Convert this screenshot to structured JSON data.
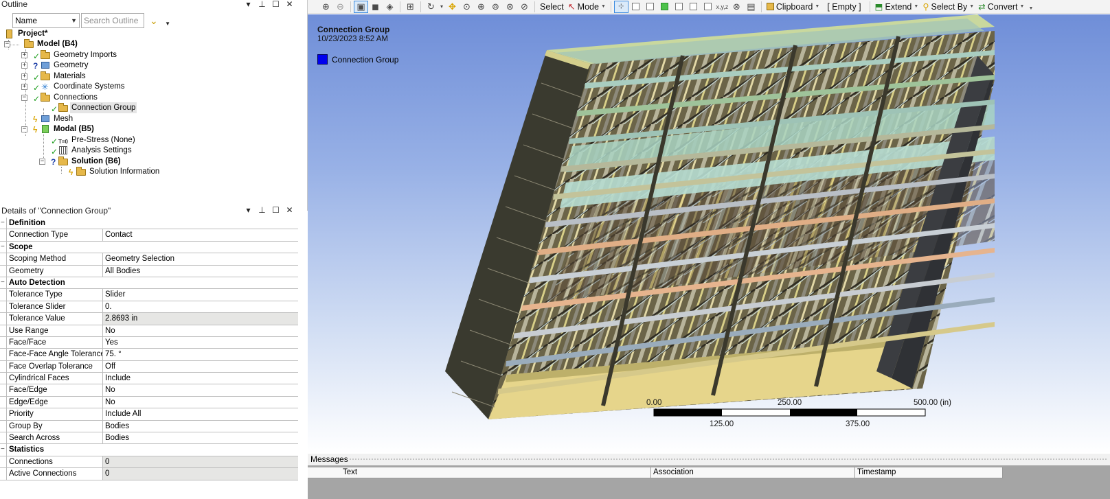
{
  "outline": {
    "title": "Outline",
    "filter_select": "Name",
    "search_placeholder": "Search Outline",
    "controls": [
      "▾",
      "📌",
      "☐",
      "✕"
    ],
    "tree": [
      {
        "label": "Project*",
        "bold": true
      },
      {
        "label": "Model (B4)",
        "bold": true
      },
      {
        "label": "Geometry Imports"
      },
      {
        "label": "Geometry"
      },
      {
        "label": "Materials"
      },
      {
        "label": "Coordinate Systems"
      },
      {
        "label": "Connections"
      },
      {
        "label": "Connection Group",
        "selected": true
      },
      {
        "label": "Mesh"
      },
      {
        "label": "Modal (B5)",
        "bold": true
      },
      {
        "label": "Pre-Stress (None)"
      },
      {
        "label": "Analysis Settings"
      },
      {
        "label": "Solution (B6)",
        "bold": true
      },
      {
        "label": "Solution Information"
      }
    ]
  },
  "details": {
    "title": "Details of \"Connection Group\"",
    "rows": [
      {
        "section": "Definition"
      },
      {
        "k": "Connection Type",
        "v": "Contact"
      },
      {
        "section": "Scope"
      },
      {
        "k": "Scoping Method",
        "v": "Geometry Selection"
      },
      {
        "k": "Geometry",
        "v": "All Bodies"
      },
      {
        "section": "Auto Detection"
      },
      {
        "k": "Tolerance Type",
        "v": "Slider"
      },
      {
        "k": "Tolerance Slider",
        "v": "0."
      },
      {
        "k": "Tolerance Value",
        "v": "2.8693 in",
        "ro": true
      },
      {
        "k": "Use Range",
        "v": "No"
      },
      {
        "k": "Face/Face",
        "v": "Yes"
      },
      {
        "k": "Face-Face Angle Tolerance",
        "v": "75. °"
      },
      {
        "k": "Face Overlap Tolerance",
        "v": "Off"
      },
      {
        "k": "Cylindrical Faces",
        "v": "Include"
      },
      {
        "k": "Face/Edge",
        "v": "No"
      },
      {
        "k": "Edge/Edge",
        "v": "No"
      },
      {
        "k": "Priority",
        "v": "Include All"
      },
      {
        "k": "Group By",
        "v": "Bodies"
      },
      {
        "k": "Search Across",
        "v": "Bodies"
      },
      {
        "section": "Statistics"
      },
      {
        "k": "Connections",
        "v": "0",
        "ro": true
      },
      {
        "k": "Active Connections",
        "v": "0",
        "ro": true
      }
    ]
  },
  "toolbar": {
    "select_label": "Select",
    "mode_label": "Mode",
    "clipboard_label": "Clipboard",
    "empty_label": "[ Empty ]",
    "extend_label": "Extend",
    "select_by_label": "Select By",
    "convert_label": "Convert"
  },
  "viewport": {
    "title": "Connection Group",
    "date": "10/23/2023 8:52 AM",
    "legend_label": "Connection Group",
    "legend_color": "#0000ee",
    "scale_top": [
      "0.00",
      "250.00",
      "500.00 (in)"
    ],
    "scale_bottom": [
      "125.00",
      "375.00"
    ]
  },
  "messages": {
    "title": "Messages",
    "columns": [
      "Text",
      "Association",
      "Timestamp"
    ]
  }
}
